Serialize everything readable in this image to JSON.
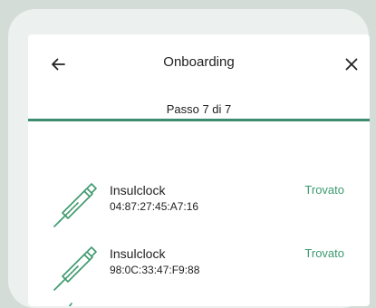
{
  "header": {
    "title": "Onboarding",
    "back_icon": "arrow-left-icon",
    "close_icon": "close-icon"
  },
  "progress": {
    "step_label": "Passo 7 di 7"
  },
  "devices": [
    {
      "name": "Insulclock",
      "mac": "04:87:27:45:A7:16",
      "status": "Trovato",
      "icon": "insulin-pen-icon"
    },
    {
      "name": "Insulclock",
      "mac": "98:0C:33:47:F9:88",
      "status": "Trovato",
      "icon": "insulin-pen-icon"
    }
  ],
  "colors": {
    "accent": "#3d8c6e",
    "status": "#3d9a6e"
  }
}
